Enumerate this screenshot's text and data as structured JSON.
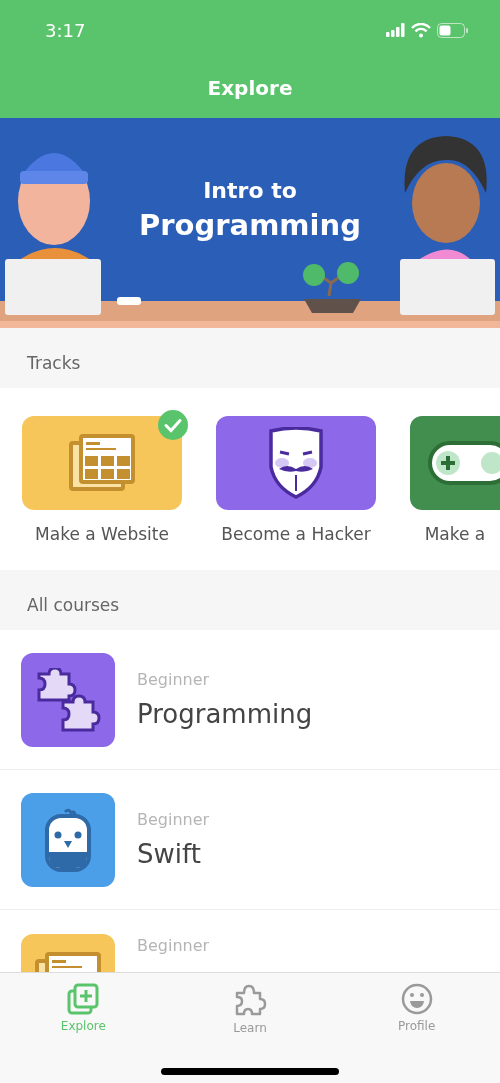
{
  "status_bar": {
    "time": "3:17"
  },
  "header": {
    "title": "Explore"
  },
  "banner": {
    "line_1": "Intro to",
    "line_2": "Programming"
  },
  "tracks": {
    "heading": "Tracks",
    "items": [
      {
        "label": "Make a Website",
        "kind": "website",
        "completed": true
      },
      {
        "label": "Become a Hacker",
        "kind": "mask",
        "completed": false
      },
      {
        "label": "Make a",
        "kind": "game",
        "completed": false
      }
    ]
  },
  "courses": {
    "heading": "All courses",
    "items": [
      {
        "level": "Beginner",
        "title": "Programming",
        "kind": "puzzle"
      },
      {
        "level": "Beginner",
        "title": "Swift",
        "kind": "bird"
      },
      {
        "level": "Beginner",
        "kind": "website"
      }
    ]
  },
  "tab_bar": [
    {
      "label": "Explore",
      "kind": "explore",
      "selected": true
    },
    {
      "label": "Learn",
      "kind": "learn",
      "selected": false
    },
    {
      "label": "Profile",
      "kind": "profile",
      "selected": false
    }
  ]
}
